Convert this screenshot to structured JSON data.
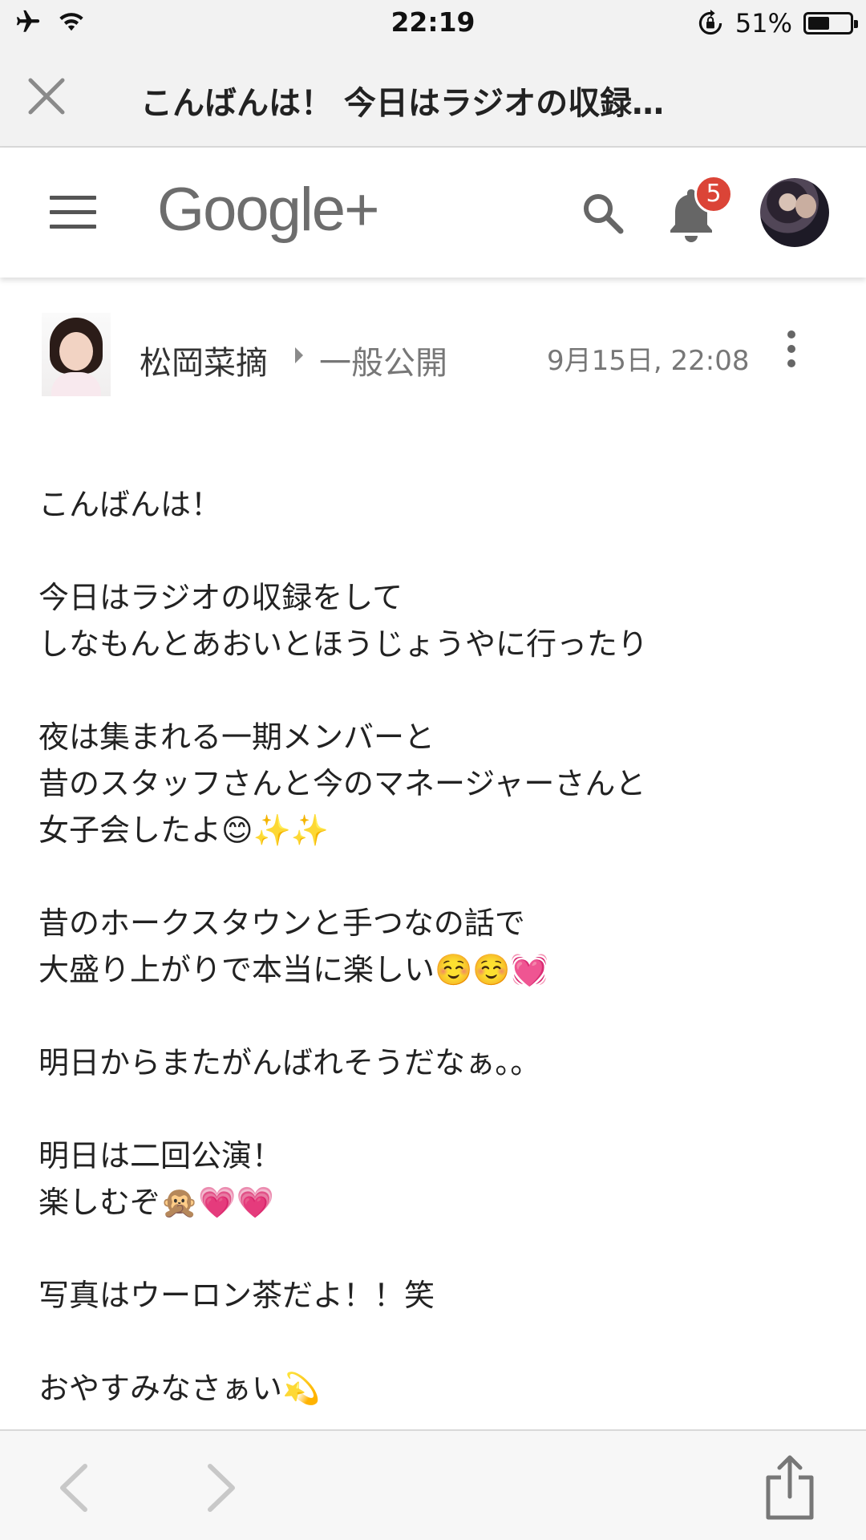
{
  "status_bar": {
    "time": "22:19",
    "battery": "51%",
    "battery_level": 0.51
  },
  "browser": {
    "title": "こんばんは！ 今日はラジオの収録…"
  },
  "app_bar": {
    "logo": "Google+",
    "notification_count": "5",
    "icons": [
      "menu-icon",
      "search-icon",
      "bell-icon",
      "avatar"
    ]
  },
  "post": {
    "author": "松岡菜摘",
    "visibility": "一般公開",
    "time": "9月15日, 22:08",
    "paragraphs": [
      [
        "こんばんは！"
      ],
      [
        "今日はラジオの収録をして",
        "しなもんとあおいとほうじょうやに行ったり"
      ],
      [
        "夜は集まれる一期メンバーと",
        "昔のスタッフさんと今のマネージャーさんと",
        "女子会したよ😊✨✨"
      ],
      [
        "昔のホークスタウンと手つなの話で",
        "大盛り上がりで本当に楽しい☺️☺️💓"
      ],
      [
        "明日からまたがんばれそうだなぁ。。"
      ],
      [
        "明日は二回公演！",
        "楽しむぞ🙊💗💗"
      ],
      [
        "写真はウーロン茶だよ！！笑"
      ],
      [
        "おやすみなさぁい💫"
      ]
    ]
  },
  "toolbar": {
    "icons": [
      "back-arrow-icon",
      "forward-arrow-icon",
      "share-icon"
    ]
  }
}
